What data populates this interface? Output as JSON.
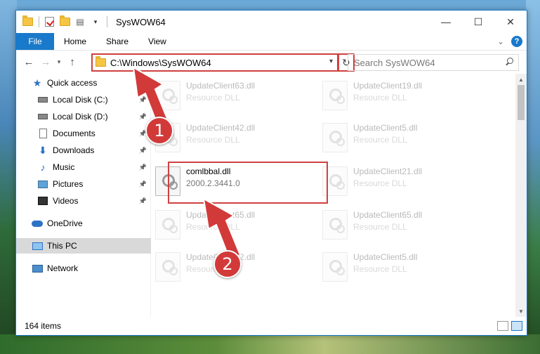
{
  "window": {
    "title": "SysWOW64",
    "controls": {
      "minimize": "—",
      "maximize": "☐",
      "close": "✕"
    }
  },
  "ribbon": {
    "tabs": [
      "File",
      "Home",
      "Share",
      "View"
    ],
    "expand_glyph": "⌄",
    "help_glyph": "?"
  },
  "address": {
    "path": "C:\\Windows\\SysWOW64",
    "search_placeholder": "Search SysWOW64"
  },
  "nav_pane": {
    "items": [
      {
        "label": "Quick access",
        "icon": "star-icon",
        "pinned": false
      },
      {
        "label": "Local Disk (C:)",
        "icon": "disk-icon",
        "pinned": true
      },
      {
        "label": "Local Disk (D:)",
        "icon": "disk-icon",
        "pinned": true
      },
      {
        "label": "Documents",
        "icon": "documents-icon",
        "pinned": true
      },
      {
        "label": "Downloads",
        "icon": "downloads-icon",
        "pinned": true
      },
      {
        "label": "Music",
        "icon": "music-icon",
        "pinned": true
      },
      {
        "label": "Pictures",
        "icon": "pictures-icon",
        "pinned": true
      },
      {
        "label": "Videos",
        "icon": "videos-icon",
        "pinned": true
      },
      {
        "label": "OneDrive",
        "icon": "onedrive-icon",
        "pinned": false
      },
      {
        "label": "This PC",
        "icon": "this-pc-icon",
        "pinned": false,
        "selected": true
      },
      {
        "label": "Network",
        "icon": "network-icon",
        "pinned": false
      }
    ]
  },
  "files": [
    {
      "name": "UpdateClient63.dll",
      "desc": "Resource DLL",
      "faded": true
    },
    {
      "name": "UpdateClient19.dll",
      "desc": "Resource DLL",
      "faded": true
    },
    {
      "name": "UpdateClient42.dll",
      "desc": "Resource DLL",
      "faded": true
    },
    {
      "name": "UpdateClient5.dll",
      "desc": "Resource DLL",
      "faded": true
    },
    {
      "name": "comlbbal.dll",
      "desc": "2000.2.3441.0",
      "faded": false
    },
    {
      "name": "UpdateClient21.dll",
      "desc": "Resource DLL",
      "faded": true
    },
    {
      "name": "UpdateClient65.dll",
      "desc": "Resource DLL",
      "faded": true
    },
    {
      "name": "UpdateClient65.dll",
      "desc": "Resource DLL",
      "faded": true
    },
    {
      "name": "UpdateClient42.dll",
      "desc": "Resource DLL",
      "faded": true
    },
    {
      "name": "UpdateClient5.dll",
      "desc": "Resource DLL",
      "faded": true
    }
  ],
  "status": {
    "item_count": "164 items"
  },
  "callouts": {
    "first": "1",
    "second": "2"
  },
  "colors": {
    "accent": "#1979ca",
    "highlight": "#d04040",
    "callout": "#d23a3a"
  }
}
